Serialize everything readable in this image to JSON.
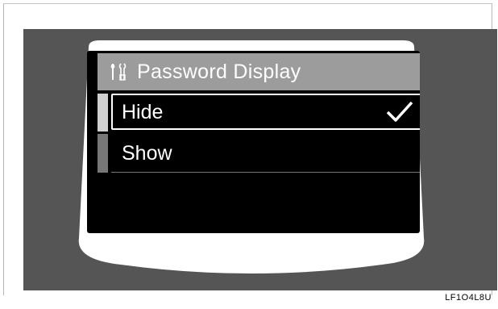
{
  "screen": {
    "title": "Password Display",
    "options": [
      {
        "label": "Hide",
        "selected": true
      },
      {
        "label": "Show",
        "selected": false
      }
    ]
  },
  "figure_code": "LF1O4L8U",
  "colors": {
    "panel": "#555555",
    "header": "#9c9c9c",
    "screen": "#000000",
    "text": "#ffffff"
  }
}
